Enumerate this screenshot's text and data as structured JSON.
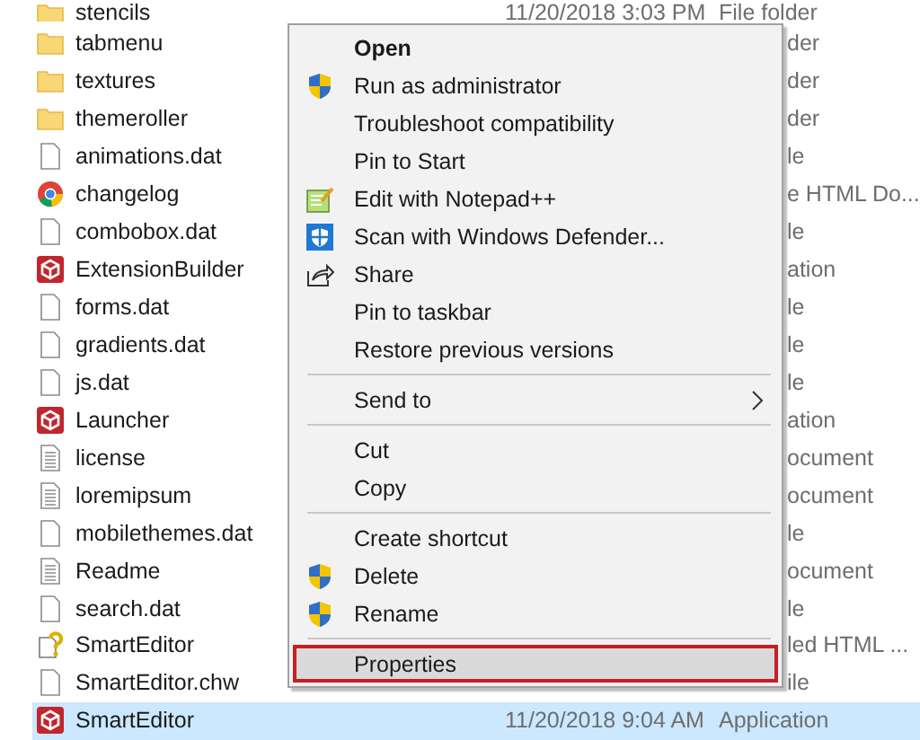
{
  "files": [
    {
      "name": "stencils",
      "kind": "folder",
      "date": "11/20/2018 3:03 PM",
      "type": "File folder",
      "selected": false
    },
    {
      "name": "tabmenu",
      "kind": "folder",
      "type": "der",
      "selected": false
    },
    {
      "name": "textures",
      "kind": "folder",
      "type": "der",
      "selected": false
    },
    {
      "name": "themeroller",
      "kind": "folder",
      "type": "der",
      "selected": false
    },
    {
      "name": "animations.dat",
      "kind": "file",
      "type": "le",
      "selected": false
    },
    {
      "name": "changelog",
      "kind": "browser",
      "type": "e HTML Do...",
      "selected": false
    },
    {
      "name": "combobox.dat",
      "kind": "file",
      "type": "le",
      "selected": false
    },
    {
      "name": "ExtensionBuilder",
      "kind": "app",
      "type": "ation",
      "selected": false
    },
    {
      "name": "forms.dat",
      "kind": "file",
      "type": "le",
      "selected": false
    },
    {
      "name": "gradients.dat",
      "kind": "file",
      "type": "le",
      "selected": false
    },
    {
      "name": "js.dat",
      "kind": "file",
      "type": "le",
      "selected": false
    },
    {
      "name": "Launcher",
      "kind": "app",
      "type": "ation",
      "selected": false
    },
    {
      "name": "license",
      "kind": "text",
      "type": "ocument",
      "selected": false
    },
    {
      "name": "loremipsum",
      "kind": "text",
      "type": "ocument",
      "selected": false
    },
    {
      "name": "mobilethemes.dat",
      "kind": "file",
      "type": "le",
      "selected": false
    },
    {
      "name": "Readme",
      "kind": "text",
      "type": "ocument",
      "selected": false
    },
    {
      "name": "search.dat",
      "kind": "file",
      "type": "le",
      "selected": false
    },
    {
      "name": "SmartEditor",
      "kind": "help",
      "type": "led HTML ...",
      "selected": false
    },
    {
      "name": "SmartEditor.chw",
      "kind": "file",
      "type": "ile",
      "selected": false
    },
    {
      "name": "SmartEditor",
      "kind": "app",
      "date": "11/20/2018 9:04 AM",
      "type": "Application",
      "selected": true
    }
  ],
  "menu": {
    "groups": [
      [
        {
          "label": "Open",
          "kind": "plain",
          "default": true,
          "submenu": false,
          "selected": false
        },
        {
          "label": "Run as administrator",
          "kind": "shield",
          "default": false,
          "submenu": false,
          "selected": false
        },
        {
          "label": "Troubleshoot compatibility",
          "kind": "plain",
          "default": false,
          "submenu": false,
          "selected": false
        },
        {
          "label": "Pin to Start",
          "kind": "plain",
          "default": false,
          "submenu": false,
          "selected": false
        },
        {
          "label": "Edit with Notepad++",
          "kind": "notepad",
          "default": false,
          "submenu": false,
          "selected": false
        },
        {
          "label": "Scan with Windows Defender...",
          "kind": "defender",
          "default": false,
          "submenu": false,
          "selected": false
        },
        {
          "label": "Share",
          "kind": "share",
          "default": false,
          "submenu": false,
          "selected": false
        },
        {
          "label": "Pin to taskbar",
          "kind": "plain",
          "default": false,
          "submenu": false,
          "selected": false
        },
        {
          "label": "Restore previous versions",
          "kind": "plain",
          "default": false,
          "submenu": false,
          "selected": false
        }
      ],
      [
        {
          "label": "Send to",
          "kind": "plain",
          "default": false,
          "submenu": true,
          "selected": false
        }
      ],
      [
        {
          "label": "Cut",
          "kind": "plain",
          "default": false,
          "submenu": false,
          "selected": false
        },
        {
          "label": "Copy",
          "kind": "plain",
          "default": false,
          "submenu": false,
          "selected": false
        }
      ],
      [
        {
          "label": "Create shortcut",
          "kind": "plain",
          "default": false,
          "submenu": false,
          "selected": false
        },
        {
          "label": "Delete",
          "kind": "shield",
          "default": false,
          "submenu": false,
          "selected": false
        },
        {
          "label": "Rename",
          "kind": "shield",
          "default": false,
          "submenu": false,
          "selected": false
        }
      ],
      [
        {
          "label": "Properties",
          "kind": "plain",
          "default": false,
          "submenu": false,
          "selected": true
        }
      ]
    ]
  }
}
